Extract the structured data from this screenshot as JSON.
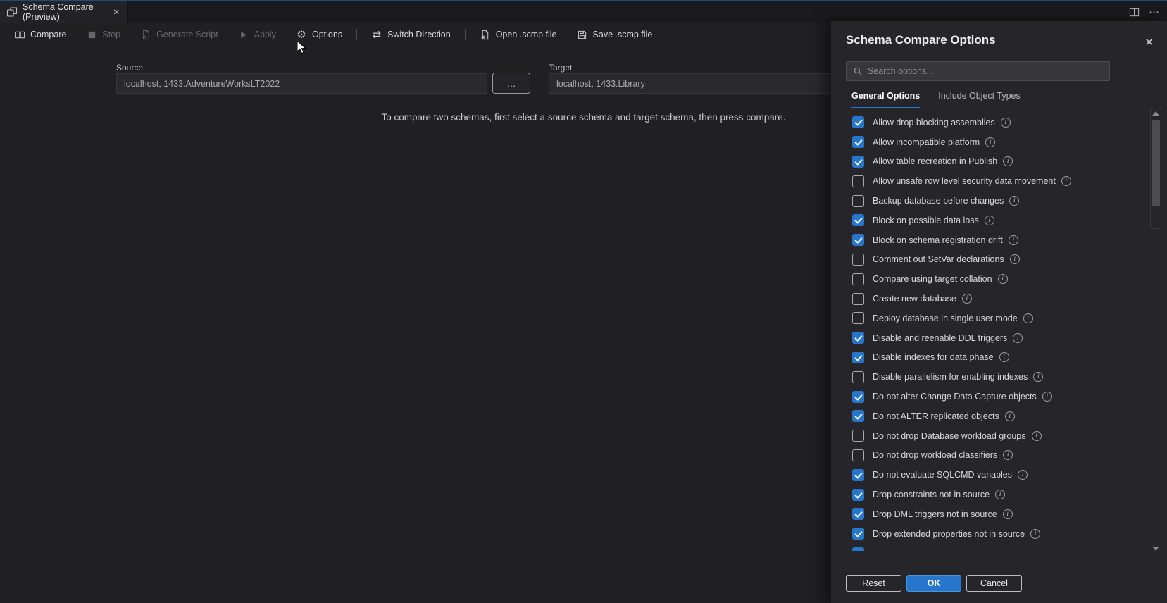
{
  "window": {
    "tab": {
      "title": "Schema Compare (Preview)",
      "icon": "schema-compare-icon",
      "close_glyph": "✕"
    },
    "tabstrip_actions": {
      "split_editor_icon": "split-editor-icon",
      "more_actions_glyph": "⋯"
    }
  },
  "toolbar": {
    "items": [
      {
        "label": "Compare",
        "icon": "compare-icon",
        "enabled": true,
        "separator_after": false
      },
      {
        "label": "Stop",
        "icon": "stop-icon",
        "enabled": false,
        "separator_after": false
      },
      {
        "label": "Generate Script",
        "icon": "generate-script-icon",
        "enabled": false,
        "separator_after": false
      },
      {
        "label": "Apply",
        "icon": "apply-icon",
        "enabled": false,
        "separator_after": false
      },
      {
        "label": "Options",
        "icon": "gear-icon",
        "enabled": true,
        "separator_after": true
      },
      {
        "label": "Switch Direction",
        "icon": "switch-direction-icon",
        "enabled": true,
        "separator_after": true
      },
      {
        "label": "Open .scmp file",
        "icon": "open-file-icon",
        "enabled": true,
        "separator_after": false
      },
      {
        "label": "Save .scmp file",
        "icon": "save-icon",
        "enabled": true,
        "separator_after": false
      }
    ]
  },
  "compare_form": {
    "source_label": "Source",
    "source_value": "localhost, 1433.AdventureWorksLT2022",
    "source_browse_label": "…",
    "target_label": "Target",
    "target_value": "localhost, 1433.Library",
    "empty_message": "To compare two schemas, first select a source schema and target schema, then press compare."
  },
  "options_panel": {
    "title": "Schema Compare Options",
    "close_glyph": "✕",
    "search": {
      "icon": "search-icon",
      "placeholder": "Search options..."
    },
    "tabs": [
      {
        "label": "General Options",
        "active": true
      },
      {
        "label": "Include Object Types",
        "active": false
      }
    ],
    "options": [
      {
        "label": "Allow drop blocking assemblies",
        "checked": true
      },
      {
        "label": "Allow incompatible platform",
        "checked": true
      },
      {
        "label": "Allow table recreation in Publish",
        "checked": true
      },
      {
        "label": "Allow unsafe row level security data movement",
        "checked": false
      },
      {
        "label": "Backup database before changes",
        "checked": false
      },
      {
        "label": "Block on possible data loss",
        "checked": true
      },
      {
        "label": "Block on schema registration drift",
        "checked": true
      },
      {
        "label": "Comment out SetVar declarations",
        "checked": false
      },
      {
        "label": "Compare using target collation",
        "checked": false
      },
      {
        "label": "Create new database",
        "checked": false
      },
      {
        "label": "Deploy database in single user mode",
        "checked": false
      },
      {
        "label": "Disable and reenable DDL triggers",
        "checked": true
      },
      {
        "label": "Disable indexes for data phase",
        "checked": true
      },
      {
        "label": "Disable parallelism for enabling indexes",
        "checked": false
      },
      {
        "label": "Do not alter Change Data Capture objects",
        "checked": true
      },
      {
        "label": "Do not ALTER replicated objects",
        "checked": true
      },
      {
        "label": "Do not drop Database workload groups",
        "checked": false
      },
      {
        "label": "Do not drop workload classifiers",
        "checked": false
      },
      {
        "label": "Do not evaluate SQLCMD variables",
        "checked": true
      },
      {
        "label": "Drop constraints not in source",
        "checked": true
      },
      {
        "label": "Drop DML triggers not in source",
        "checked": true
      },
      {
        "label": "Drop extended properties not in source",
        "checked": true
      },
      {
        "label": "",
        "checked": true,
        "partial": true
      }
    ],
    "footer": {
      "reset_label": "Reset",
      "ok_label": "OK",
      "cancel_label": "Cancel"
    }
  },
  "colors": {
    "accent_blue": "#2677cb",
    "top_accent": "#1d4d80",
    "panel_bg": "#26262a",
    "editor_bg": "#202023"
  }
}
